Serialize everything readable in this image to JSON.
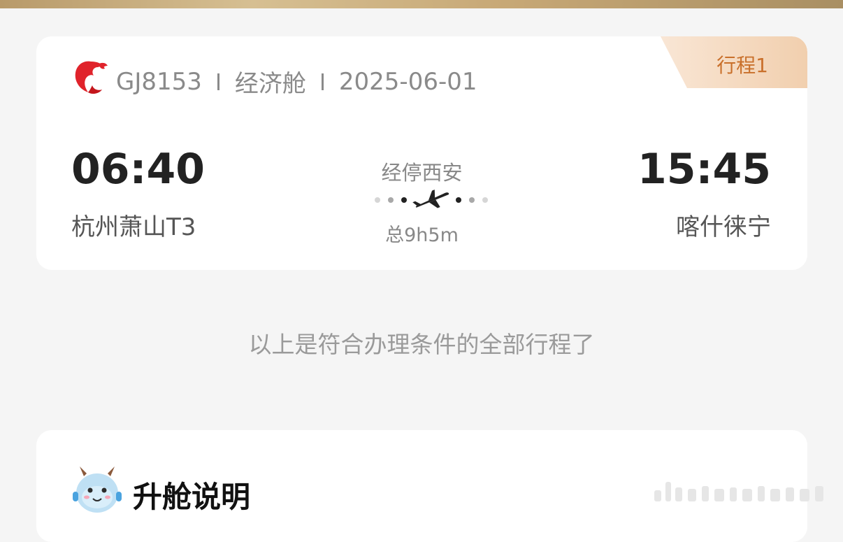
{
  "flight": {
    "number": "GJ8153",
    "cabin": "经济舱",
    "date": "2025-06-01",
    "trip_tag": "行程1",
    "departure": {
      "time": "06:40",
      "airport": "杭州萧山T3"
    },
    "arrival": {
      "time": "15:45",
      "airport": "喀什徕宁"
    },
    "stopover": "经停西安",
    "duration": "总9h5m"
  },
  "note": "以上是符合办理条件的全部行程了",
  "upgrade": {
    "title": "升舱说明"
  },
  "colors": {
    "accent": "#c9702b",
    "logo_red": "#e0232b",
    "background": "#f5f5f5"
  }
}
